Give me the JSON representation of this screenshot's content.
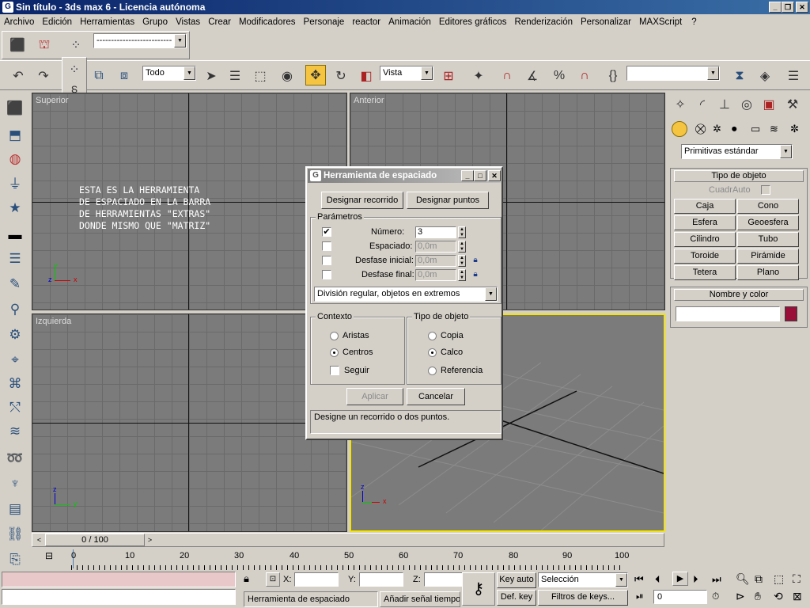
{
  "window": {
    "title": "Sin título - 3ds max 6 - Licencia autónoma"
  },
  "menu": [
    "Archivo",
    "Edición",
    "Herramientas",
    "Grupo",
    "Vistas",
    "Crear",
    "Modificadores",
    "Personaje",
    "reactor",
    "Animación",
    "Editores gráficos",
    "Renderización",
    "Personalizar",
    "MAXScript",
    "?"
  ],
  "toolbar": {
    "named_selection": "--------------------------",
    "selection_filter": "Todo",
    "reference_coord": "Vista"
  },
  "viewports": {
    "top_label": "Superior",
    "front_label": "Anterior",
    "left_label": "Izquierda"
  },
  "annotation": {
    "line1": "ESTA ES LA HERRAMIENTA",
    "line2": "DE ESPACIADO EN LA BARRA",
    "line3": "DE HERRAMIENTAS \"EXTRAS\"",
    "line4": "DONDE MISMO QUE \"MATRIZ\""
  },
  "dialog": {
    "title": "Herramienta de espaciado",
    "btn_path": "Designar recorrido",
    "btn_points": "Designar puntos",
    "params_title": "Parámetros",
    "numero_label": "Número:",
    "numero_value": "3",
    "numero_checked": true,
    "espaciado_label": "Espaciado:",
    "espaciado_value": "0,0m",
    "desfase_inicial_label": "Desfase inicial:",
    "desfase_inicial_value": "0,0m",
    "desfase_final_label": "Desfase final:",
    "desfase_final_value": "0,0m",
    "distribution": "División regular, objetos en extremos",
    "context_title": "Contexto",
    "ctx_aristas": "Aristas",
    "ctx_centros": "Centros",
    "ctx_seguir": "Seguir",
    "objtype_title": "Tipo de objeto",
    "obj_copia": "Copia",
    "obj_calco": "Calco",
    "obj_referencia": "Referencia",
    "btn_apply": "Aplicar",
    "btn_cancel": "Cancelar",
    "status": "Designe un recorrido o dos puntos."
  },
  "command_panel": {
    "category": "Primitivas estándar",
    "rollout_object_type": "Tipo de objeto",
    "autogrid": "CuadrAuto",
    "buttons": [
      "Caja",
      "Cono",
      "Esfera",
      "Geoesfera",
      "Cilindro",
      "Tubo",
      "Toroide",
      "Pirámide",
      "Tetera",
      "Plano"
    ],
    "rollout_name_color": "Nombre y color",
    "color_swatch": "#9a0f3a"
  },
  "timeline": {
    "frame_counter": "0 / 100",
    "ticks": [
      "0",
      "10",
      "20",
      "30",
      "40",
      "50",
      "60",
      "70",
      "80",
      "90",
      "100"
    ]
  },
  "status_bar": {
    "x_label": "X:",
    "y_label": "Y:",
    "z_label": "Z:",
    "key_auto": "Key auto",
    "def_key": "Def. key",
    "selection": "Selección",
    "key_filters": "Filtros de keys...",
    "tool_name": "Herramienta de espaciado",
    "add_time_tag": "Añadir señal tiempo",
    "frame_value": "0"
  }
}
